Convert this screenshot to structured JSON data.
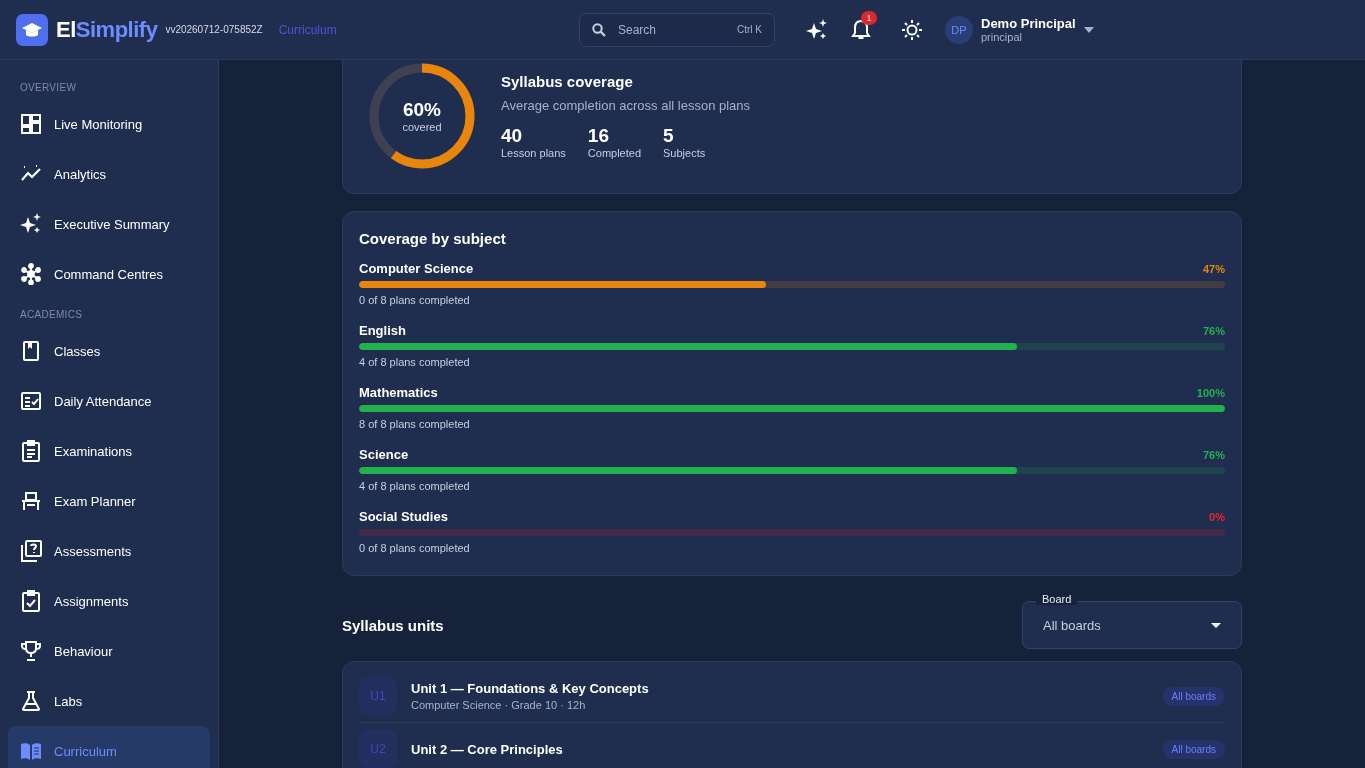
{
  "header": {
    "brand_prefix": "El",
    "brand_suffix": "Simplify",
    "version": "vv20260712-075852Z",
    "breadcrumb": "Curriculum",
    "search": {
      "placeholder": "Search",
      "shortcut": "Ctrl K"
    },
    "notification_count": "1",
    "user": {
      "initials": "DP",
      "name": "Demo Principal",
      "role": "principal"
    }
  },
  "sidebar": {
    "sections": [
      {
        "title": "OVERVIEW",
        "items": [
          {
            "label": "Live Monitoring",
            "selected": false
          },
          {
            "label": "Analytics",
            "selected": false
          },
          {
            "label": "Executive Summary",
            "selected": false
          },
          {
            "label": "Command Centres",
            "selected": false
          }
        ]
      },
      {
        "title": "ACADEMICS",
        "items": [
          {
            "label": "Classes",
            "selected": false
          },
          {
            "label": "Daily Attendance",
            "selected": false
          },
          {
            "label": "Examinations",
            "selected": false
          },
          {
            "label": "Exam Planner",
            "selected": false
          },
          {
            "label": "Assessments",
            "selected": false
          },
          {
            "label": "Assignments",
            "selected": false
          },
          {
            "label": "Behaviour",
            "selected": false
          },
          {
            "label": "Labs",
            "selected": false
          },
          {
            "label": "Curriculum",
            "selected": true
          }
        ]
      }
    ]
  },
  "summary": {
    "title": "Syllabus coverage",
    "subtitle": "Average completion across all lesson plans",
    "level": 0.6,
    "percent": "60%",
    "percent_label": "covered",
    "stats": [
      {
        "value": "40",
        "label": "Lesson plans"
      },
      {
        "value": "16",
        "label": "Completed"
      },
      {
        "value": "5",
        "label": "Subjects"
      }
    ]
  },
  "coverage": {
    "title": "Coverage by subject",
    "subjects": [
      {
        "name": "Computer Science",
        "percent": "47%",
        "level": 0.47,
        "color": "#e8850c",
        "detail": "0 of 8 plans completed"
      },
      {
        "name": "English",
        "percent": "76%",
        "level": 0.76,
        "color": "#22b14c",
        "detail": "4 of 8 plans completed"
      },
      {
        "name": "Mathematics",
        "percent": "100%",
        "level": 1,
        "color": "#22b14c",
        "detail": "8 of 8 plans completed"
      },
      {
        "name": "Science",
        "percent": "76%",
        "level": 0.76,
        "color": "#22b14c",
        "detail": "4 of 8 plans completed"
      },
      {
        "name": "Social Studies",
        "percent": "0%",
        "level": 0,
        "color": "#e8262c",
        "detail": "0 of 8 plans completed"
      }
    ]
  },
  "units": {
    "title": "Syllabus units",
    "filter": {
      "label": "Board",
      "value": "All boards"
    },
    "items": [
      {
        "code": "U1",
        "title": "Unit 1 — Foundations & Key Concepts",
        "meta": "Computer Science · Grade 10 · 12h",
        "tag": "All boards"
      },
      {
        "code": "U2",
        "title": "Unit 2 — Core Principles",
        "tag": "All boards"
      }
    ]
  }
}
